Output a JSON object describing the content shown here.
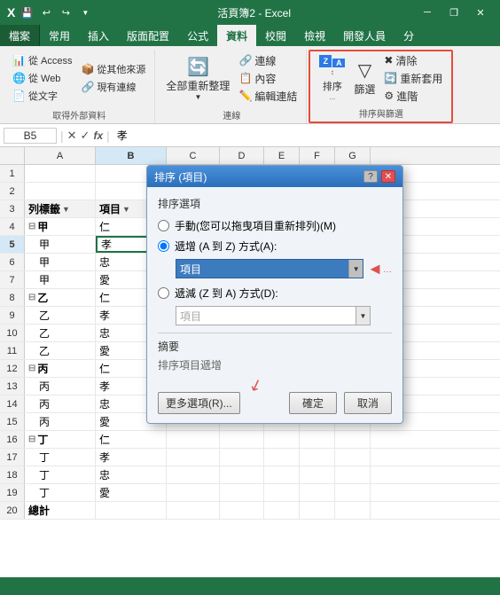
{
  "titlebar": {
    "title": "活頁簿2 - Excel",
    "quickaccess": [
      "save",
      "undo",
      "redo"
    ],
    "controls": [
      "minimize",
      "restore",
      "close"
    ]
  },
  "ribbon": {
    "tabs": [
      "檔案",
      "常用",
      "插入",
      "版面配置",
      "公式",
      "資料",
      "校閱",
      "檢視",
      "開發人員",
      "分"
    ],
    "active_tab": "資料",
    "groups": [
      {
        "label": "取得外部資料",
        "buttons": [
          {
            "label": "從 Access",
            "icon": "📊"
          },
          {
            "label": "從 Web",
            "icon": "🌐"
          },
          {
            "label": "從文字",
            "icon": "📄"
          },
          {
            "label": "從其他來源",
            "icon": "📦"
          },
          {
            "label": "現有連線",
            "icon": "🔗"
          }
        ]
      },
      {
        "label": "連線",
        "buttons": [
          {
            "label": "連線",
            "icon": "🔗"
          },
          {
            "label": "內容",
            "icon": "📋"
          },
          {
            "label": "編輯連結",
            "icon": "✏️"
          },
          {
            "label": "全部重新整理",
            "icon": "🔄"
          }
        ]
      },
      {
        "label": "排序與篩選",
        "buttons": [
          {
            "label": "排序",
            "icon": "sort"
          },
          {
            "label": "篩選",
            "icon": "▼"
          },
          {
            "label": "清除",
            "icon": "✖"
          },
          {
            "label": "重新套用",
            "icon": "🔄"
          },
          {
            "label": "進階",
            "icon": "⚙"
          }
        ]
      }
    ]
  },
  "formula_bar": {
    "cell_ref": "B5",
    "formula": "孝"
  },
  "spreadsheet": {
    "columns": [
      "A",
      "B",
      "C",
      "D",
      "E",
      "F",
      "G"
    ],
    "active_cell": "B5",
    "rows": [
      {
        "num": 1,
        "cells": [
          "",
          "",
          "",
          "",
          "",
          "",
          ""
        ]
      },
      {
        "num": 2,
        "cells": [
          "",
          "",
          "",
          "",
          "",
          "",
          ""
        ]
      },
      {
        "num": 3,
        "cells": [
          "列標籤",
          "項目",
          "",
          "",
          "",
          "",
          ""
        ]
      },
      {
        "num": 4,
        "cells": [
          "⊟甲",
          "仁",
          "",
          "",
          "",
          "",
          ""
        ]
      },
      {
        "num": 5,
        "cells": [
          "甲",
          "孝",
          "",
          "",
          "",
          "",
          ""
        ]
      },
      {
        "num": 6,
        "cells": [
          "甲",
          "忠",
          "",
          "",
          "",
          "",
          ""
        ]
      },
      {
        "num": 7,
        "cells": [
          "甲",
          "愛",
          "",
          "",
          "",
          "",
          ""
        ]
      },
      {
        "num": 8,
        "cells": [
          "⊟乙",
          "仁",
          "",
          "",
          "",
          "",
          ""
        ]
      },
      {
        "num": 9,
        "cells": [
          "乙",
          "孝",
          "",
          "",
          "",
          "",
          ""
        ]
      },
      {
        "num": 10,
        "cells": [
          "乙",
          "忠",
          "",
          "",
          "",
          "",
          ""
        ]
      },
      {
        "num": 11,
        "cells": [
          "乙",
          "愛",
          "",
          "",
          "",
          "",
          ""
        ]
      },
      {
        "num": 12,
        "cells": [
          "⊟丙",
          "仁",
          "",
          "",
          "",
          "",
          ""
        ]
      },
      {
        "num": 13,
        "cells": [
          "丙",
          "孝",
          "",
          "",
          "",
          "",
          ""
        ]
      },
      {
        "num": 14,
        "cells": [
          "丙",
          "忠",
          "",
          "",
          "",
          "",
          ""
        ]
      },
      {
        "num": 15,
        "cells": [
          "丙",
          "愛",
          "",
          "",
          "",
          "",
          ""
        ]
      },
      {
        "num": 16,
        "cells": [
          "⊟丁",
          "仁",
          "",
          "",
          "",
          "",
          ""
        ]
      },
      {
        "num": 17,
        "cells": [
          "丁",
          "孝",
          "",
          "",
          "",
          "",
          ""
        ]
      },
      {
        "num": 18,
        "cells": [
          "丁",
          "忠",
          "",
          "",
          "",
          "",
          ""
        ]
      },
      {
        "num": 19,
        "cells": [
          "丁",
          "愛",
          "",
          "",
          "",
          "",
          ""
        ]
      },
      {
        "num": 20,
        "cells": [
          "總計",
          "",
          "",
          "",
          "",
          "",
          ""
        ]
      }
    ]
  },
  "sort_dialog": {
    "title": "排序 (項目)",
    "section_title": "排序選項",
    "option1": {
      "label": "手動(您可以拖曳項目重新排列)(M)",
      "selected": false
    },
    "option2": {
      "label": "遞增 (A 到 Z) 方式(A):",
      "selected": true,
      "dropdown_value": "項目",
      "dropdown_arrow": "←..."
    },
    "option3": {
      "label": "遞減 (Z 到 A) 方式(D):",
      "selected": false,
      "dropdown_value": "項目"
    },
    "summary_label": "摘要",
    "summary_text": "排序項目遞增",
    "buttons": {
      "more": "更多選項(R)...",
      "ok": "確定",
      "cancel": "取消"
    }
  }
}
